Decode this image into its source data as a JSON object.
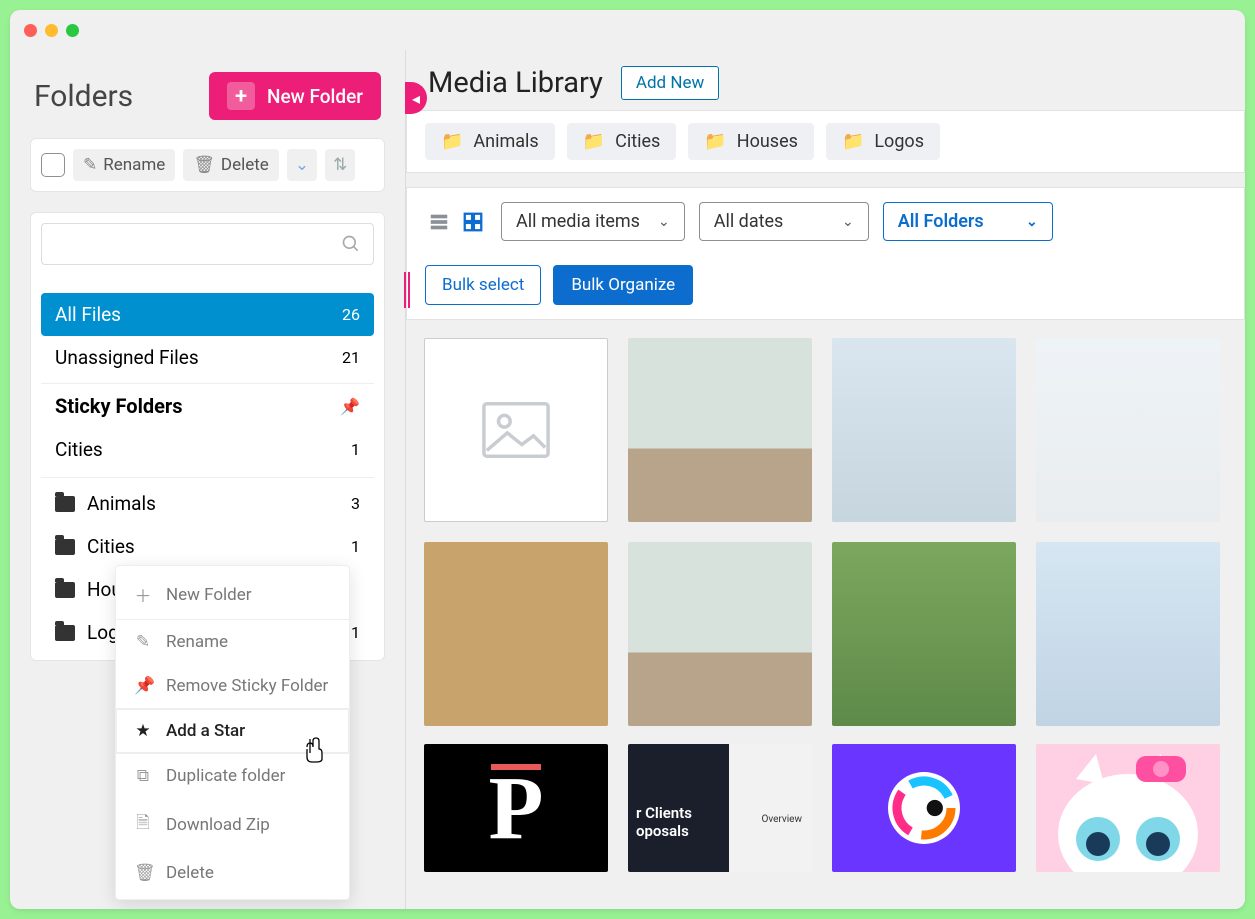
{
  "sidebar": {
    "title": "Folders",
    "new_folder_btn": "New Folder",
    "rename_btn": "Rename",
    "delete_btn": "Delete",
    "rows": {
      "all_files": {
        "label": "All Files",
        "count": "26"
      },
      "unassigned": {
        "label": "Unassigned Files",
        "count": "21"
      },
      "sticky_header": "Sticky Folders",
      "sticky_items": [
        {
          "label": "Cities",
          "count": "1"
        }
      ],
      "folders": [
        {
          "label": "Animals",
          "count": "3"
        },
        {
          "label": "Cities",
          "count": "1"
        },
        {
          "label": "Houses",
          "count": ""
        },
        {
          "label": "Logos",
          "count": "1"
        }
      ]
    }
  },
  "context_menu": {
    "items": [
      {
        "label": "New Folder",
        "icon": "plus"
      },
      {
        "label": "Rename",
        "icon": "pencil"
      },
      {
        "label": "Remove Sticky Folder",
        "icon": "pin"
      },
      {
        "label": "Add a Star",
        "icon": "star",
        "hover": true
      },
      {
        "label": "Duplicate folder",
        "icon": "copy"
      },
      {
        "label": "Download Zip",
        "icon": "file"
      },
      {
        "label": "Delete",
        "icon": "trash"
      }
    ]
  },
  "main": {
    "title": "Media Library",
    "add_new": "Add New",
    "chips": [
      "Animals",
      "Cities",
      "Houses",
      "Logos"
    ],
    "filters": {
      "media_items": "All media items",
      "dates": "All dates",
      "folders": "All Folders",
      "bulk_select": "Bulk select",
      "bulk_organize": "Bulk Organize"
    },
    "doc_thumb": {
      "line1": "r Clients",
      "line2": "oposals",
      "right": "Overview"
    }
  }
}
